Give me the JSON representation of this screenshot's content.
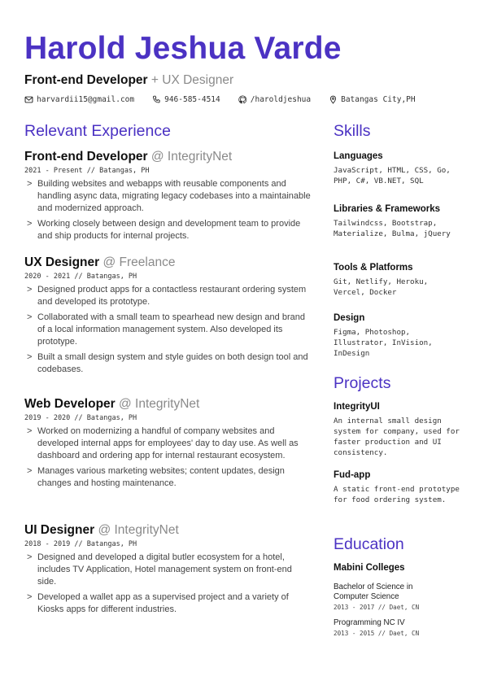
{
  "header": {
    "name": "Harold Jeshua Varde",
    "role": "Front-end Developer",
    "alt_role": "+ UX Designer",
    "contacts": [
      {
        "icon": "mail-icon",
        "text": "harvardii15@gmail.com"
      },
      {
        "icon": "phone-icon",
        "text": "946-585-4514"
      },
      {
        "icon": "github-icon",
        "text": "/haroldjeshua"
      },
      {
        "icon": "location-pin-icon",
        "text": "Batangas City,PH"
      }
    ]
  },
  "experience": {
    "title": "Relevant Experience",
    "jobs": [
      {
        "role": "Front-end Developer",
        "company": "@ IntegrityNet",
        "meta": "2021 - Present // Batangas, PH",
        "bullets": [
          "Building websites and webapps with reusable components and handling async data, migrating legacy codebases into a maintainable and modernized approach.",
          "Working closely between design and development team to provide and ship products for internal projects."
        ]
      },
      {
        "role": "UX Designer",
        "company": "@ Freelance",
        "meta": "2020 - 2021 // Batangas, PH",
        "bullets": [
          "Designed product apps for a contactless restaurant ordering system and developed its prototype.",
          "Collaborated with a small team to spearhead new design and brand of a local information management system. Also developed its prototype.",
          "Built a small design system and style guides on both design tool and codebases."
        ]
      },
      {
        "role": "Web Developer",
        "company": "@ IntegrityNet",
        "meta": "2019 - 2020 // Batangas, PH",
        "bullets": [
          "Worked on modernizing a handful of company websites and developed internal apps for employees' day to day use. As well as dashboard and ordering app for internal restaurant ecosystem.",
          "Manages various marketing websites; content updates, design changes and hosting maintenance."
        ]
      },
      {
        "role": "UI Designer",
        "company": "@ IntegrityNet",
        "meta": "2018 - 2019 // Batangas, PH",
        "bullets": [
          "Designed and developed a digital butler ecosystem for a hotel, includes TV Application, Hotel management system on front-end side.",
          "Developed a wallet app as a supervised project and a variety of Kiosks apps for different industries."
        ]
      }
    ]
  },
  "skills": {
    "title": "Skills",
    "groups": [
      {
        "heading": "Languages",
        "items": "JavaScript, HTML, CSS, Go, PHP, C#, VB.NET, SQL"
      },
      {
        "heading": "Libraries & Frameworks",
        "items": "Tailwindcss, Bootstrap, Materialize, Bulma, jQuery"
      },
      {
        "heading": "Tools & Platforms",
        "items": "Git, Netlify, Heroku, Vercel, Docker"
      },
      {
        "heading": "Design",
        "items": "Figma, Photoshop, Illustrator, InVision, InDesign"
      }
    ]
  },
  "projects": {
    "title": "Projects",
    "items": [
      {
        "name": "IntegrityUI",
        "desc": "An internal small design system for company, used for faster production and UI consistency."
      },
      {
        "name": "Fud-app",
        "desc": "A static front-end prototype for food ordering system."
      }
    ]
  },
  "education": {
    "title": "Education",
    "school": "Mabini Colleges",
    "entries": [
      {
        "degree": "Bachelor of Science in Computer Science",
        "meta": "2013 - 2017 // Daet, CN"
      },
      {
        "degree": "Programming NC IV",
        "meta": "2013 - 2015 // Daet, CN"
      }
    ]
  }
}
